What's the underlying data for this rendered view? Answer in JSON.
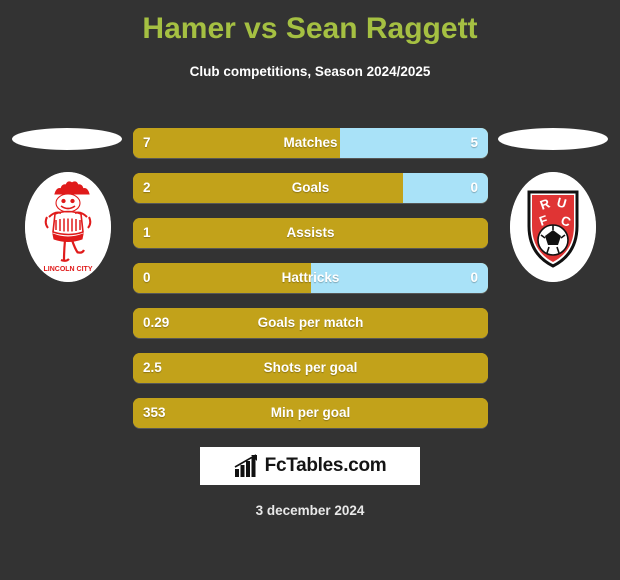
{
  "header": {
    "title": "Hamer vs Sean Raggett",
    "subtitle": "Club competitions, Season 2024/2025",
    "title_color": "#a5c042"
  },
  "colors": {
    "background": "#333333",
    "bar_left": "#c2a21a",
    "bar_right": "#a9e2f8",
    "text": "#ffffff"
  },
  "players": {
    "left": {
      "club": "Lincoln City",
      "crest_text": "LINCOLN CITY",
      "photo_placeholder": ""
    },
    "right": {
      "club": "Rotherham United",
      "crest_text": "R.U.F.C",
      "photo_placeholder": ""
    }
  },
  "chart_data": {
    "type": "bar",
    "title": "Hamer vs Sean Raggett",
    "subtitle": "Club competitions, Season 2024/2025",
    "orientation": "horizontal-diverging",
    "series": [
      {
        "name": "Hamer",
        "color": "#c2a21a"
      },
      {
        "name": "Sean Raggett",
        "color": "#a9e2f8"
      }
    ],
    "categories": [
      "Matches",
      "Goals",
      "Assists",
      "Hattricks",
      "Goals per match",
      "Shots per goal",
      "Min per goal"
    ],
    "rows": [
      {
        "label": "Matches",
        "left": "7",
        "right": "5",
        "left_pct": 58.3,
        "has_right": true
      },
      {
        "label": "Goals",
        "left": "2",
        "right": "0",
        "left_pct": 76.0,
        "has_right": true
      },
      {
        "label": "Assists",
        "left": "1",
        "right": "",
        "left_pct": 100.0,
        "has_right": false
      },
      {
        "label": "Hattricks",
        "left": "0",
        "right": "0",
        "left_pct": 50.0,
        "has_right": true
      },
      {
        "label": "Goals per match",
        "left": "0.29",
        "right": "",
        "left_pct": 100.0,
        "has_right": false
      },
      {
        "label": "Shots per goal",
        "left": "2.5",
        "right": "",
        "left_pct": 100.0,
        "has_right": false
      },
      {
        "label": "Min per goal",
        "left": "353",
        "right": "",
        "left_pct": 100.0,
        "has_right": false
      }
    ]
  },
  "footer": {
    "logo_text": "FcTables.com",
    "logo_icon": "bar-chart-icon",
    "date": "3 december 2024"
  }
}
